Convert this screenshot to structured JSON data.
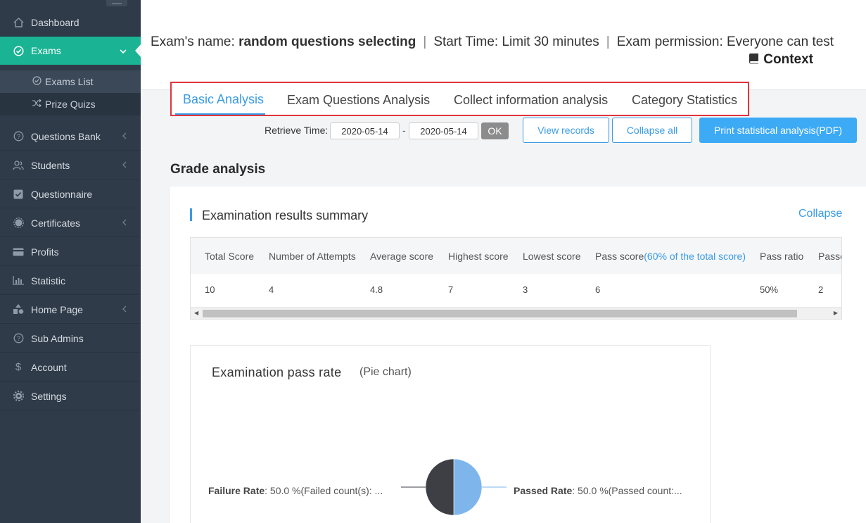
{
  "sidebar": {
    "items": [
      {
        "label": "Dashboard",
        "icon": "home-icon",
        "chevron": false
      },
      {
        "label": "Exams",
        "icon": "check-circle-icon",
        "chevron": true,
        "active": true
      },
      {
        "label": "Questions Bank",
        "icon": "question-circle-icon",
        "chevron": true
      },
      {
        "label": "Students",
        "icon": "users-icon",
        "chevron": true
      },
      {
        "label": "Questionnaire",
        "icon": "checkbox-icon",
        "chevron": false
      },
      {
        "label": "Certificates",
        "icon": "certificate-icon",
        "chevron": true
      },
      {
        "label": "Profits",
        "icon": "credit-card-icon",
        "chevron": false
      },
      {
        "label": "Statistic",
        "icon": "bar-chart-icon",
        "chevron": false
      },
      {
        "label": "Home Page",
        "icon": "shapes-icon",
        "chevron": true
      },
      {
        "label": "Sub Admins",
        "icon": "question-circle-icon",
        "chevron": false
      },
      {
        "label": "Account",
        "icon": "dollar-icon",
        "chevron": false
      },
      {
        "label": "Settings",
        "icon": "gear-icon",
        "chevron": false
      }
    ],
    "sub_items": [
      {
        "label": "Exams List",
        "icon": "check-circle-icon",
        "selected": true
      },
      {
        "label": "Prize Quizs",
        "icon": "shuffle-icon",
        "selected": false
      }
    ]
  },
  "header": {
    "name_prefix": "Exam's name: ",
    "name_value": "random questions selecting",
    "separator": "|",
    "start_time": "Start Time: Limit 30 minutes",
    "permission": "Exam permission: Everyone can test",
    "context_label": "Context"
  },
  "tabs": [
    {
      "label": "Basic Analysis",
      "active": true
    },
    {
      "label": "Exam Questions Analysis",
      "active": false
    },
    {
      "label": "Collect information analysis",
      "active": false
    },
    {
      "label": "Category Statistics",
      "active": false
    }
  ],
  "filter": {
    "retrieve_label": "Retrieve Time:",
    "start_date": "2020-05-14",
    "dash": "-",
    "end_date": "2020-05-14",
    "ok_label": "OK",
    "view_records_label": "View records",
    "collapse_all_label": "Collapse all",
    "print_label": "Print statistical analysis(PDF)"
  },
  "grade": {
    "title": "Grade analysis",
    "summary_title": "Examination results summary",
    "collapse_label": "Collapse",
    "columns": [
      "Total Score",
      "Number of Attempts",
      "Average score",
      "Highest score",
      "Lowest score",
      "Pass score",
      "Pass ratio",
      "Passed"
    ],
    "pass_score_note": "(60% of the total score)",
    "row": [
      "10",
      "4",
      "4.8",
      "7",
      "3",
      "6",
      "50%",
      "2"
    ]
  },
  "pass_chart": {
    "title": "Examination pass rate",
    "subtitle": "(Pie chart)",
    "failure_key": "Failure Rate",
    "failure_text": ": 50.0 %(Failed count(s): ...",
    "passed_key": "Passed Rate",
    "passed_text": ": 50.0 %(Passed count:...",
    "colors": {
      "failed": "#3e3f45",
      "passed": "#7eb6ec"
    }
  },
  "chart_data": {
    "type": "pie",
    "categories": [
      "Failure Rate",
      "Passed Rate"
    ],
    "values": [
      50.0,
      50.0
    ],
    "title": "Examination pass rate"
  },
  "colors": {
    "accent": "#1ab394",
    "link": "#3a9be6",
    "sidebar": "#2f3b49",
    "highlight_border": "#e0343d"
  }
}
